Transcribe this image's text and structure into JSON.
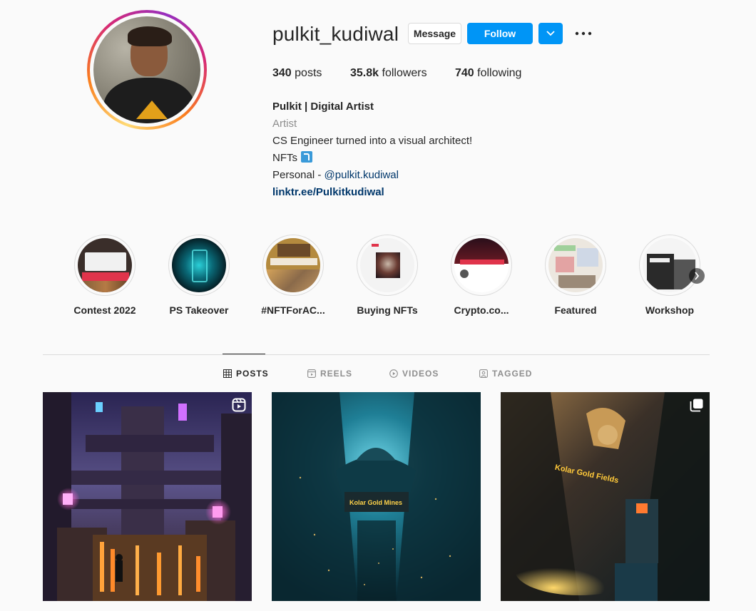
{
  "profile": {
    "username": "pulkit_kudiwal",
    "buttons": {
      "message": "Message",
      "follow": "Follow"
    },
    "stats": {
      "posts_count": "340",
      "posts_label": "posts",
      "followers_count": "35.8k",
      "followers_label": "followers",
      "following_count": "740",
      "following_label": "following"
    },
    "bio": {
      "name": "Pulkit | Digital Artist",
      "category": "Artist",
      "line1": "CS Engineer turned into a visual architect!",
      "line2": "NFTs",
      "line3_prefix": "Personal - ",
      "line3_mention": "@pulkit.kudiwal",
      "website": "linktr.ee/Pulkitkudiwal"
    }
  },
  "highlights": [
    {
      "label": "Contest 2022"
    },
    {
      "label": "PS Takeover"
    },
    {
      "label": "#NFTForAC..."
    },
    {
      "label": "Buying NFTs"
    },
    {
      "label": "Crypto.co..."
    },
    {
      "label": "Featured"
    },
    {
      "label": "Workshop"
    }
  ],
  "tabs": [
    {
      "label": "POSTS",
      "icon": "grid-icon",
      "active": true
    },
    {
      "label": "REELS",
      "icon": "reels-icon",
      "active": false
    },
    {
      "label": "VIDEOS",
      "icon": "play-icon",
      "active": false
    },
    {
      "label": "TAGGED",
      "icon": "tagged-icon",
      "active": false
    }
  ],
  "posts": [
    {
      "sign": "",
      "badge": "reel-icon"
    },
    {
      "sign": "Kolar Gold Mines",
      "badge": ""
    },
    {
      "sign": "Kolar Gold Fields",
      "badge": "carousel-icon"
    }
  ],
  "colors": {
    "accent": "#0095f6",
    "link": "#00376b",
    "text": "#262626",
    "muted": "#8e8e8e"
  }
}
